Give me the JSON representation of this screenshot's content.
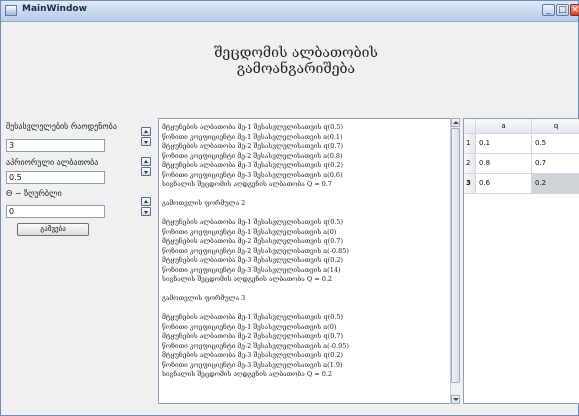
{
  "window": {
    "title": "MainWindow",
    "minimize_glyph": "_",
    "maximize_glyph": "□",
    "close_glyph": "×"
  },
  "heading": "შეცდომის ალბათობის გამოანგარიშება",
  "form": {
    "label_count": "შესასვლელების რაოდენობა",
    "count_value": "3",
    "label_apriori": "აპრიორული ალბათობა",
    "apriori_value": "0.5",
    "label_theta": "Θ − ზღურბლი",
    "theta_value": "0",
    "calc_label": "გაშვება"
  },
  "output": {
    "lines": [
      "მტყუნების ალბათობა მე-1 შესასვლელისათვის q(0.5)",
      "წონითი კოეფიციენტი მე-1 შესასვლელისათვის a(0.1)",
      "მტყუნების ალბათობა მე-2 შესასვლელისათვის q(0.7)",
      "წონითი კოეფიციენტი მე-2 შესასვლელისათვის a(0.8)",
      "მტყუნების ალბათობა მე-3 შესასვლელისათვის q(0.2)",
      "წონითი კოეფიციენტი მე-3 შესასვლელისათვის a(0.6)",
      "სიგნალის შეცდომის აღდგენის ალბათობა Q = 0.7",
      "",
      "გამოთვლის ფორმულა 2",
      "",
      "მტყუნების ალბათობა მე-1 შესასვლელისათვის q(0.5)",
      "წონითი კოეფიციენტი მე-1 შესასვლელისათვის a(0)",
      "მტყუნების ალბათობა მე-2 შესასვლელისათვის q(0.7)",
      "წონითი კოეფიციენტი მე-2 შესასვლელისათვის a(-0.85)",
      "მტყუნების ალბათობა მე-3 შესასვლელისათვის q(0.2)",
      "წონითი კოეფიციენტი მე-3 შესასვლელისათვის a(14)",
      "სიგნალის შეცდომის აღდგენის ალბათობა Q = 0.2",
      "",
      "გამოთვლის ფორმულა 3",
      "",
      "მტყუნების ალბათობა მე-1 შესასვლელისათვის q(0.5)",
      "წონითი კოეფიციენტი მე-1 შესასვლელისათვის a(0)",
      "მტყუნების ალბათობა მე-2 შესასვლელისათვის q(0.7)",
      "წონითი კოეფიციენტი მე-2 შესასვლელისათვის a(-0.95)",
      "მტყუნების ალბათობა მე-3 შესასვლელისათვის q(0.2)",
      "წონითი კოეფიციენტი მე-3 შესასვლელისათვის a(1.9)",
      "სიგნალის შეცდომის აღდგენის ალბათობა Q = 0.2"
    ]
  },
  "table": {
    "columns": [
      "a",
      "q"
    ],
    "rows": [
      {
        "index": "1",
        "a": "0.1",
        "q": "0.5"
      },
      {
        "index": "2",
        "a": "0.8",
        "q": "0.7"
      },
      {
        "index": "3",
        "a": "0.6",
        "q": "0.2"
      }
    ]
  }
}
